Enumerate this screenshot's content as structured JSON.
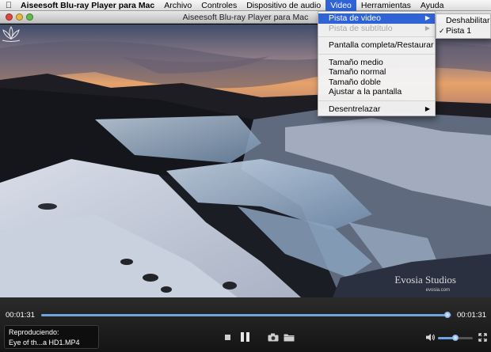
{
  "menubar": {
    "apple_icon": "apple-icon",
    "items": [
      {
        "label": "Aiseesoft Blu-ray Player para Mac",
        "bold": true
      },
      {
        "label": "Archivo"
      },
      {
        "label": "Controles"
      },
      {
        "label": "Dispositivo de audio"
      },
      {
        "label": "Video",
        "active": true
      },
      {
        "label": "Herramientas"
      },
      {
        "label": "Ayuda"
      }
    ]
  },
  "window": {
    "title": "Aiseesoft Blu-ray Player para Mac"
  },
  "video_menu": {
    "items": [
      {
        "label": "Pista de video",
        "highlighted": true,
        "submenu": true
      },
      {
        "label": "Pista de subtítulo",
        "disabled": true,
        "submenu": true
      },
      {
        "label": "Pantalla completa/Restaurar"
      },
      {
        "label": "Tamaño medio"
      },
      {
        "label": "Tamaño normal"
      },
      {
        "label": "Tamaño doble"
      },
      {
        "label": "Ajustar a la pantalla"
      },
      {
        "label": "Desentrelazar",
        "submenu": true
      }
    ]
  },
  "video_track_submenu": {
    "items": [
      {
        "label": "Deshabilitar",
        "checked": false
      },
      {
        "label": "Pista 1",
        "checked": true
      }
    ]
  },
  "video": {
    "watermark": "Evosia Studios",
    "watermark_sub": "evosia.com"
  },
  "player": {
    "current_time": "00:01:31",
    "total_time": "00:01:31",
    "progress": 0.99,
    "now_playing_label": "Reproduciendo:",
    "now_playing_file": "Eye of th...a HD1.MP4",
    "volume": 0.5
  },
  "colors": {
    "menu_highlight": "#2f63d6",
    "progress": "#6fa4e0"
  }
}
